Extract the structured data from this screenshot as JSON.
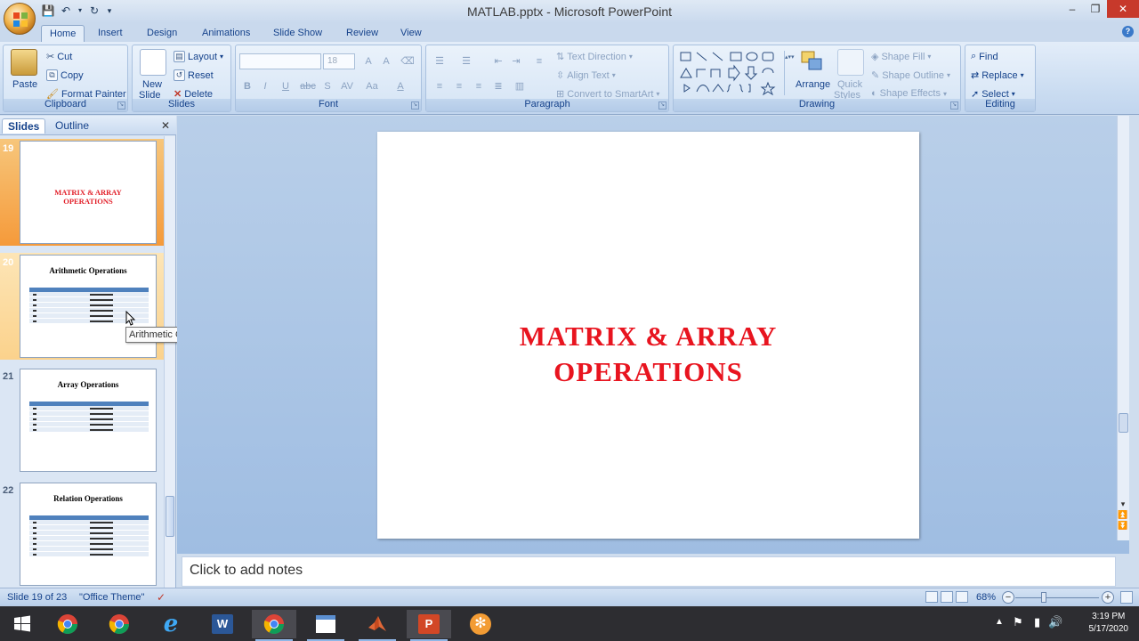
{
  "window": {
    "title": "MATLAB.pptx - Microsoft PowerPoint",
    "controls": [
      "–",
      "❐",
      "✕"
    ]
  },
  "ribbon_tabs": [
    "Home",
    "Insert",
    "Design",
    "Animations",
    "Slide Show",
    "Review",
    "View"
  ],
  "active_tab": "Home",
  "ribbon": {
    "clipboard": {
      "label": "Clipboard",
      "paste": "Paste",
      "cut": "Cut",
      "copy": "Copy",
      "format_painter": "Format Painter"
    },
    "slides": {
      "label": "Slides",
      "new_slide_line1": "New",
      "new_slide_line2": "Slide",
      "layout": "Layout",
      "reset": "Reset",
      "delete": "Delete"
    },
    "font": {
      "label": "Font",
      "font_name": "",
      "font_size": "18",
      "bold": "B",
      "italic": "I",
      "underline": "U",
      "strike": "abc",
      "shadow": "S",
      "spacing": "AV",
      "case": "Aa",
      "color": "A"
    },
    "paragraph": {
      "label": "Paragraph",
      "text_direction": "Text Direction",
      "align_text": "Align Text",
      "convert_smartart": "Convert to SmartArt"
    },
    "drawing": {
      "label": "Drawing",
      "arrange": "Arrange",
      "quick_styles_line1": "Quick",
      "quick_styles_line2": "Styles",
      "shape_fill": "Shape Fill",
      "shape_outline": "Shape Outline",
      "shape_effects": "Shape Effects"
    },
    "editing": {
      "label": "Editing",
      "find": "Find",
      "replace": "Replace",
      "select": "Select"
    }
  },
  "pane": {
    "tabs": [
      "Slides",
      "Outline"
    ],
    "active_tab": "Slides",
    "slides": [
      {
        "number": "19",
        "title": "MATRIX & ARRAY\nOPERATIONS",
        "kind": "section",
        "state": "selected"
      },
      {
        "number": "20",
        "title": "Arithmetic Operations",
        "kind": "table",
        "state": "hover",
        "rows": 6
      },
      {
        "number": "21",
        "title": "Array Operations",
        "kind": "table",
        "state": "normal",
        "rows": 5
      },
      {
        "number": "22",
        "title": "Relation Operations",
        "kind": "table",
        "state": "normal",
        "rows": 7
      }
    ]
  },
  "tooltip": "Arithmetic Operations",
  "main_slide": {
    "title_line1": "MATRIX & ARRAY",
    "title_line2": "OPERATIONS",
    "title_color": "#e8141f"
  },
  "notes_placeholder": "Click to add notes",
  "status": {
    "slide_info": "Slide 19 of 23",
    "theme": "\"Office Theme\"",
    "zoom": "68%"
  },
  "taskbar": {
    "apps": [
      "windows-start",
      "chrome",
      "chrome",
      "internet-explorer",
      "word",
      "chrome",
      "calendar",
      "matlab",
      "powerpoint",
      "snip"
    ],
    "clock_time": "3:19 PM",
    "clock_date": "5/17/2020"
  }
}
